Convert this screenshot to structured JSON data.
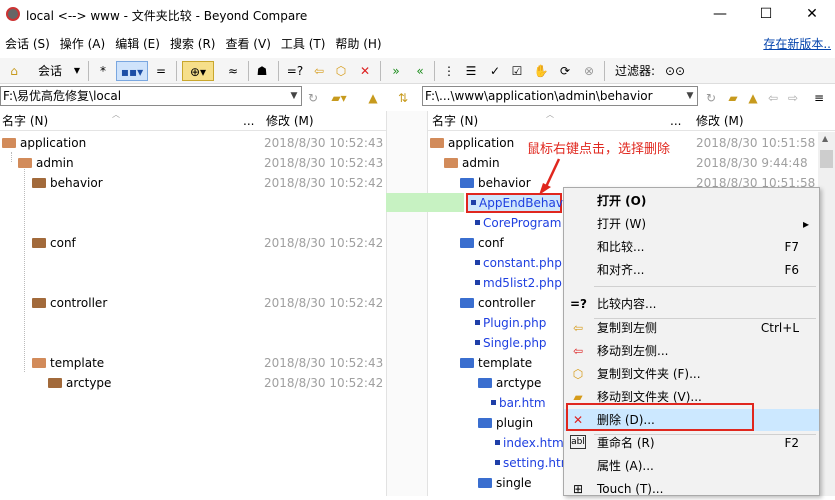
{
  "window": {
    "title": "local <--> www - 文件夹比较 - Beyond Compare",
    "minimize": "—",
    "maximize": "☐",
    "close": "✕"
  },
  "menu": {
    "items": [
      "会话 (S)",
      "操作 (A)",
      "编辑 (E)",
      "搜索 (R)",
      "查看 (V)",
      "工具 (T)",
      "帮助 (H)"
    ],
    "new_version": "存在新版本.."
  },
  "toolbar": {
    "session": "会话",
    "star": "*",
    "equal": "=",
    "approx": "≈",
    "equal_q": "=?",
    "filter_label": "过滤器:"
  },
  "left": {
    "path": "F:\\易优高危修复\\local",
    "col_name": "名字 (N)",
    "col_dots": "...",
    "col_modified": "修改 (M)",
    "rows": [
      {
        "name": "application",
        "date": "2018/8/30 10:52:43"
      },
      {
        "name": "admin",
        "date": "2018/8/30 10:52:43"
      },
      {
        "name": "behavior",
        "date": "2018/8/30 10:52:42"
      },
      {
        "name": "conf",
        "date": "2018/8/30 10:52:42"
      },
      {
        "name": "controller",
        "date": "2018/8/30 10:52:42"
      },
      {
        "name": "template",
        "date": "2018/8/30 10:52:43"
      },
      {
        "name": "arctype",
        "date": "2018/8/30 10:52:42"
      }
    ]
  },
  "right": {
    "path": "F:\\...\\www\\application\\admin\\behavior",
    "col_name": "名字 (N)",
    "col_dots": "...",
    "col_modified": "修改 (M)",
    "rows": [
      {
        "name": "application",
        "date": "2018/8/30 10:51:58"
      },
      {
        "name": "admin",
        "date": "2018/8/30 9:44:48"
      },
      {
        "name": "behavior",
        "date": "2018/8/30 10:51:58"
      },
      {
        "name": "AppEndBehav",
        "date": ""
      },
      {
        "name": "CoreProgram",
        "date": ""
      },
      {
        "name": "conf",
        "date": ""
      },
      {
        "name": "constant.php",
        "date": ""
      },
      {
        "name": "md5list2.php",
        "date": ""
      },
      {
        "name": "controller",
        "date": ""
      },
      {
        "name": "Plugin.php",
        "date": ""
      },
      {
        "name": "Single.php",
        "date": ""
      },
      {
        "name": "template",
        "date": ""
      },
      {
        "name": "arctype",
        "date": ""
      },
      {
        "name": "bar.htm",
        "date": ""
      },
      {
        "name": "plugin",
        "date": ""
      },
      {
        "name": "index.htm",
        "date": ""
      },
      {
        "name": "setting.htm",
        "date": ""
      },
      {
        "name": "single",
        "date": ""
      }
    ]
  },
  "annotation": "鼠标右键点击，选择删除",
  "context_menu": {
    "items": [
      {
        "label": "打开 (O)",
        "shortcut": ""
      },
      {
        "label": "打开 (W)",
        "shortcut": "▸"
      },
      {
        "label": "和比较...",
        "shortcut": "F7"
      },
      {
        "label": "和对齐...",
        "shortcut": "F6"
      },
      {
        "label": "比较内容...",
        "shortcut": ""
      },
      {
        "label": "复制到左侧",
        "shortcut": "Ctrl+L"
      },
      {
        "label": "移动到左侧...",
        "shortcut": ""
      },
      {
        "label": "复制到文件夹 (F)...",
        "shortcut": ""
      },
      {
        "label": "移动到文件夹 (V)...",
        "shortcut": ""
      },
      {
        "label": "删除 (D)...",
        "shortcut": ""
      },
      {
        "label": "重命名 (R)",
        "shortcut": "F2"
      },
      {
        "label": "属性 (A)...",
        "shortcut": ""
      },
      {
        "label": "Touch (T)...",
        "shortcut": ""
      }
    ]
  },
  "colors": {
    "highlight": "#cce8ff",
    "annot_red": "#e0271e",
    "diff_green": "#c7f2c2"
  }
}
